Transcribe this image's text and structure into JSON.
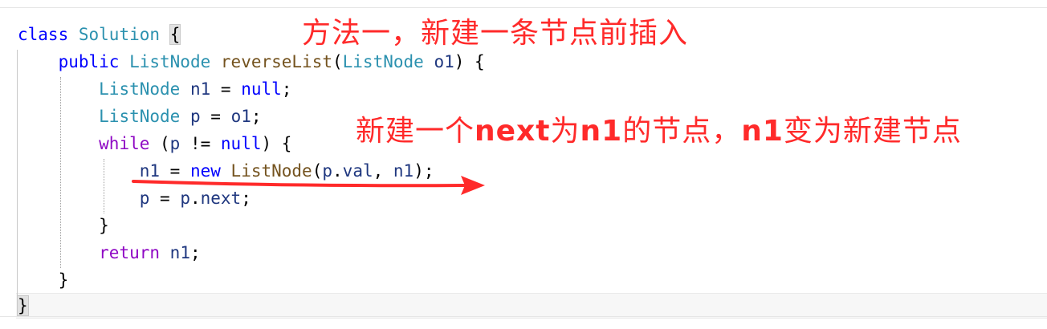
{
  "code": {
    "line1": {
      "kw": "class",
      "name": "Solution",
      "brace": "{"
    },
    "line2": {
      "kw": "public",
      "ret": "ListNode",
      "method": "reverseList",
      "open": "(",
      "ptype": "ListNode",
      "pname": "o1",
      "close": ") {"
    },
    "line3": {
      "type": "ListNode",
      "name": "n1",
      "eq": " = ",
      "val": "null",
      "end": ";"
    },
    "line4": {
      "type": "ListNode",
      "name": "p",
      "eq": " = ",
      "val": "o1",
      "end": ";"
    },
    "line5": {
      "kw": "while",
      "open": " (",
      "var": "p",
      "op": " != ",
      "val": "null",
      "close": ") {"
    },
    "line6": {
      "var": "n1",
      "eq": " = ",
      "kw": "new",
      "ctor": "ListNode",
      "open": "(",
      "obj": "p",
      "dot": ".",
      "field": "val",
      "comma": ", ",
      "arg": "n1",
      "close": ");"
    },
    "line7": {
      "var": "p",
      "eq": " = ",
      "obj": "p",
      "dot": ".",
      "field": "next",
      "end": ";"
    },
    "line8": {
      "brace": "}"
    },
    "line9": {
      "kw": "return",
      "var": "n1",
      "end": ";"
    },
    "line10": {
      "brace": "}"
    },
    "line11": {
      "brace": "}"
    }
  },
  "annotations": {
    "title": "方法一，新建一条节点前插入",
    "note_part1": "新建一个",
    "note_bold1": "next",
    "note_part2": "为",
    "note_bold2": "n1",
    "note_part3": "的节点，",
    "note_bold3": "n1",
    "note_part4": "变为新建节点"
  },
  "colors": {
    "keyword": "#0000ff",
    "control_keyword": "#8f08c4",
    "type": "#2b91af",
    "method": "#74531f",
    "variable": "#1f377f",
    "annotation": "#ff2a2a"
  }
}
